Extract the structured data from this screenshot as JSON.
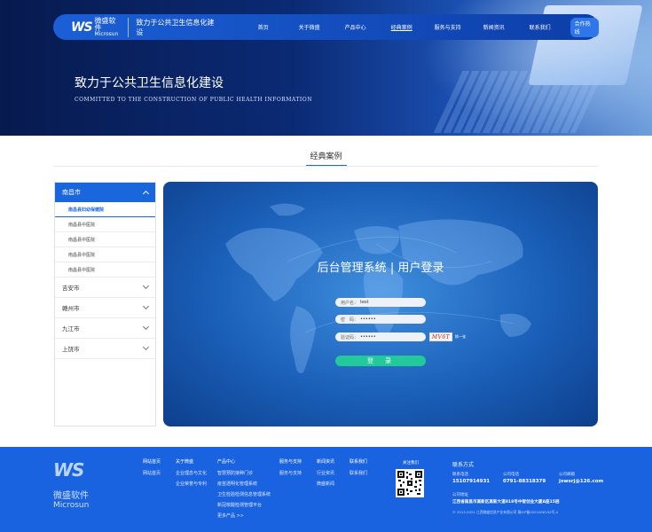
{
  "header": {
    "logo_mark": "WS",
    "logo_cn": "微盛软件",
    "logo_en": "Microsun",
    "slogan": "致力于公共卫生信息化建设",
    "nav": [
      "首页",
      "关于微盛",
      "产品中心",
      "经典案例",
      "服务与支持",
      "新闻资讯",
      "联系我们"
    ],
    "hotline": "合作热线"
  },
  "hero": {
    "title": "致力于公共卫生信息化建设",
    "subtitle": "COMMITTED TO THE CONSTRUCTION OF PUBLIC HEALTH INFORMATION"
  },
  "section": {
    "title": "经典案例"
  },
  "sidebar": {
    "head": "南昌市",
    "sub_items": [
      "南昌县妇幼保健院",
      "南昌县中医院",
      "南昌县中医院",
      "南昌县中医院",
      "南昌县中医院"
    ],
    "cities": [
      "吉安市",
      "赣州市",
      "九江市",
      "上饶市"
    ]
  },
  "login": {
    "title_left": "后台管理系统",
    "title_right": "用户登录",
    "username_label": "用户名：",
    "username_value": "test",
    "password_label": "密　码：",
    "password_value": "••••••",
    "captcha_label": "验证码：",
    "captcha_value": "••••••",
    "captcha_image": "MV6T",
    "refresh": "换一张",
    "button": "登　录"
  },
  "footer": {
    "logo_mark": "WS",
    "logo_cn": "微盛软件",
    "logo_en": "Microsun",
    "columns": [
      {
        "head": "网站首页",
        "items": [
          "网站首页"
        ]
      },
      {
        "head": "关于微盛",
        "items": [
          "企业理念与文化",
          "企业荣誉与专利"
        ]
      },
      {
        "head": "产品中心",
        "items": [
          "智慧预防接种门诊",
          "疫苗透明化管理系统",
          "卫生检验检测信息管理系统",
          "新冠核酸检测管理平台",
          "更多产品 >>"
        ]
      },
      {
        "head": "服务与支持",
        "items": [
          "服务与支持"
        ]
      },
      {
        "head": "新闻资讯",
        "items": [
          "行业资讯",
          "微盛新闻"
        ]
      },
      {
        "head": "联系我们",
        "items": [
          "联系我们"
        ]
      }
    ],
    "qr_title": "关注我们",
    "contact": {
      "title": "联系方式",
      "phone_label": "联系电话",
      "phone": "15107914931",
      "tel_label": "公司电话",
      "tel": "0791-88318379",
      "email_label": "公司邮箱",
      "email": "jxwsrj@126.com",
      "address_label": "公司地址",
      "address": "江西省南昌市高新区高新大道818号中智创业大厦A座15层",
      "copyright": "© 2013-2021 江西微盛信息产业有限公司 赣ICP备2021006152号-4"
    }
  },
  "colors": {
    "brand_blue": "#1a66dd",
    "login_button": "#22c99a",
    "footer_bg": "#1a63e0"
  }
}
